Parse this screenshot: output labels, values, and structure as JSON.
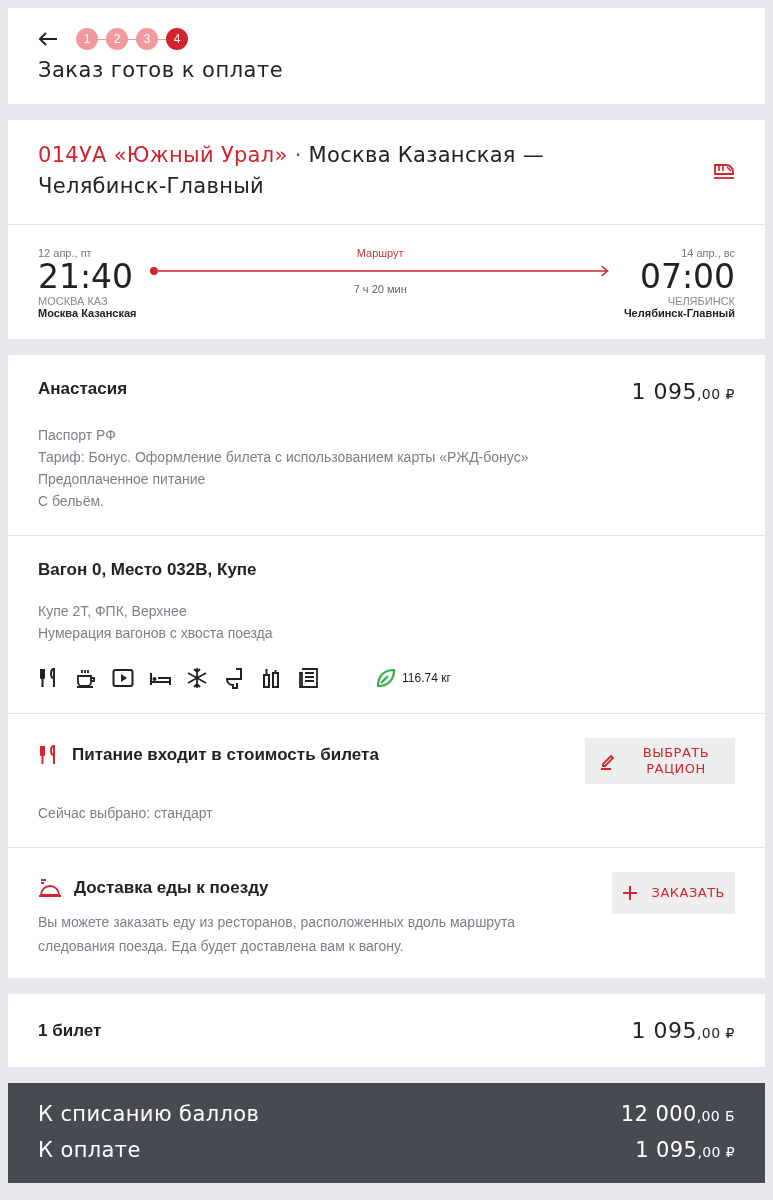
{
  "header": {
    "steps": [
      {
        "label": "1",
        "selected": false
      },
      {
        "label": "2",
        "selected": false
      },
      {
        "label": "3",
        "selected": false
      },
      {
        "label": "4",
        "selected": true
      }
    ],
    "title": "Заказ готов к оплате"
  },
  "train": {
    "number": "014УА «Южный Урал»",
    "separator": "·",
    "route": "Москва Казанская — Челябинск-Главный",
    "departure": {
      "date": "12 апр., пт",
      "time": "21:40",
      "code": "МОСКВА КАЗ",
      "station": "Москва Казанская"
    },
    "route_label": "Маршрут",
    "duration": "7 ч 20 мин",
    "arrival": {
      "date": "14 апр., вс",
      "time": "07:00",
      "code": "ЧЕЛЯБИНСК",
      "station": "Челябинск-Главный"
    }
  },
  "passenger": {
    "name": "Анастасия",
    "price_main": "1 095",
    "price_cents": ",00 ₽",
    "details": [
      "Паспорт РФ",
      "Тариф: Бонус. Оформление билета с использованием карты «РЖД-бонус»",
      "Предоплаченное питание",
      "С бельём."
    ]
  },
  "seat": {
    "title": "Вагон 0, Место 032В, Купе",
    "details": [
      "Купе 2Т, ФПК, Верхнее",
      "Нумерация вагонов с хвоста поезда"
    ],
    "amenities": [
      {
        "kind": "food"
      },
      {
        "kind": "coffee"
      },
      {
        "kind": "video"
      },
      {
        "kind": "bed"
      },
      {
        "kind": "climate"
      },
      {
        "kind": "toilet"
      },
      {
        "kind": "hygiene"
      },
      {
        "kind": "press"
      }
    ],
    "co2": "116.74 кг"
  },
  "meal": {
    "title": "Питание входит в стоимость билета",
    "note": "Сейчас выбрано: стандарт",
    "button": "ВЫБРАТЬ РАЦИОН"
  },
  "delivery": {
    "title": "Доставка еды к поезду",
    "text": "Вы можете заказать еду из ресторанов, расположенных вдоль маршрута следования поезда. Еда будет доставлена вам к вагону.",
    "button": "ЗАКАЗАТЬ"
  },
  "summary": {
    "label": "1 билет",
    "price_main": "1 095",
    "price_cents": ",00 ₽"
  },
  "totals": [
    {
      "label": "К списанию баллов",
      "main": "12 000",
      "cents": ",00 Б"
    },
    {
      "label": "К оплате",
      "main": "1 095",
      "cents": ",00 ₽"
    }
  ]
}
